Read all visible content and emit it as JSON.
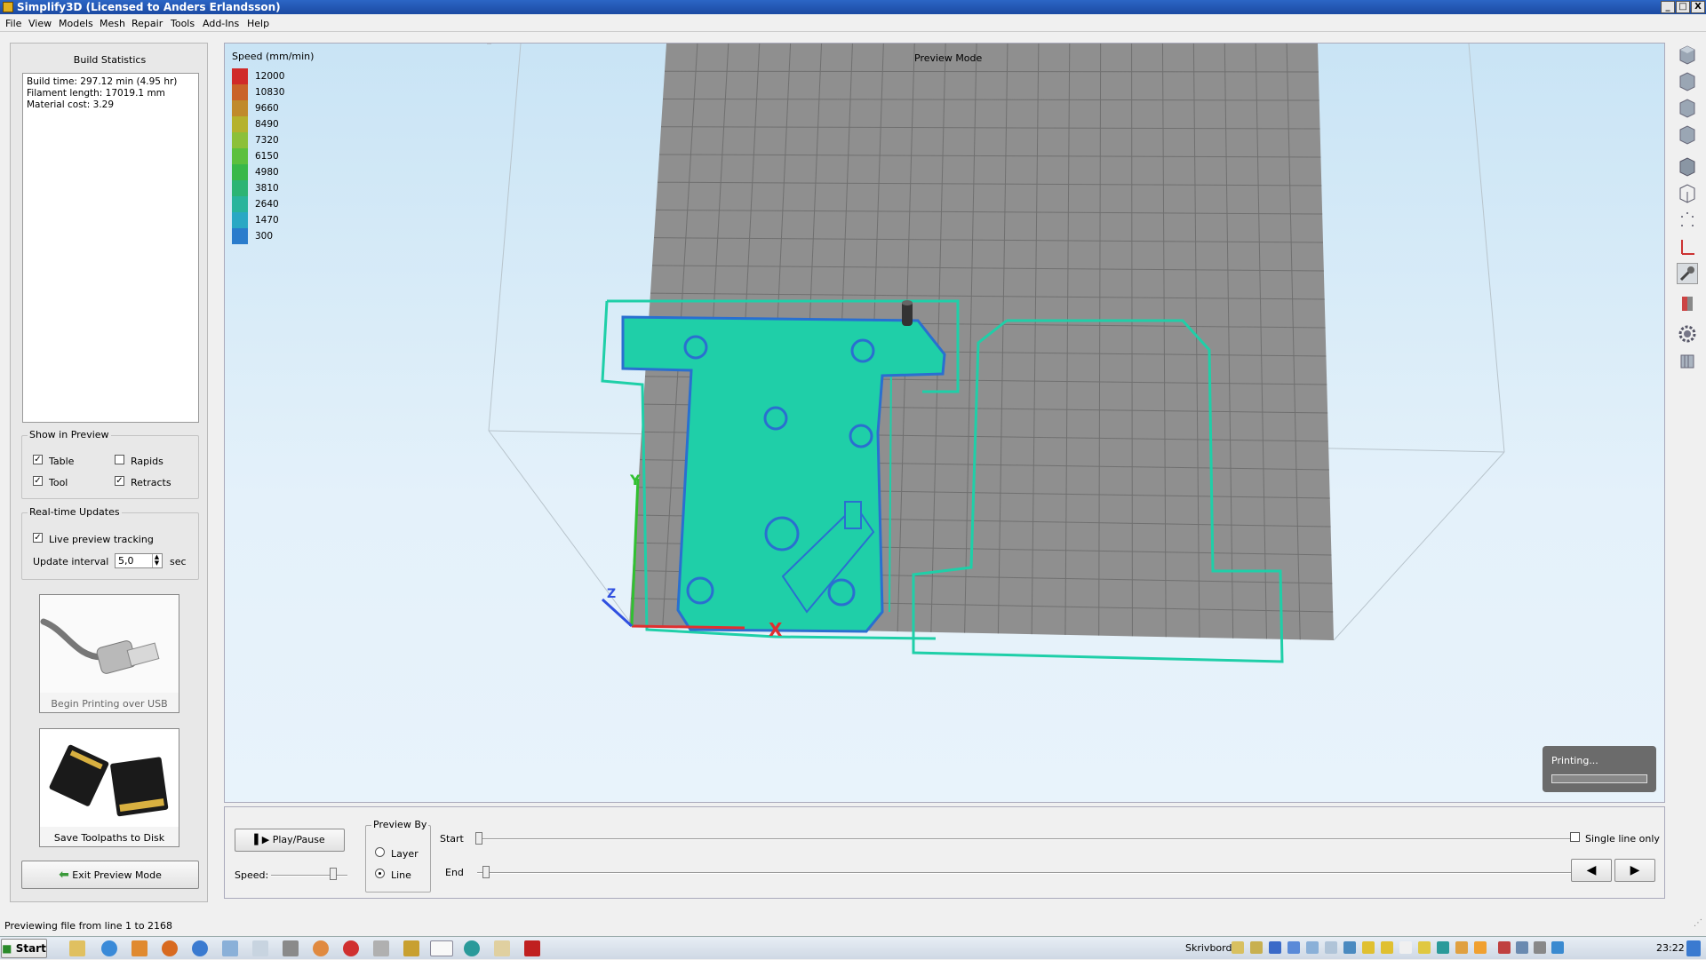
{
  "window": {
    "title": "Simplify3D (Licensed to Anders Erlandsson)",
    "minimize": "_",
    "maximize": "□",
    "close": "X"
  },
  "menu": [
    "File",
    "View",
    "Models",
    "Mesh",
    "Repair",
    "Tools",
    "Add-Ins",
    "Help"
  ],
  "build_stats": {
    "title": "Build Statistics",
    "lines": [
      "Build time: 297.12 min (4.95 hr)",
      "Filament length: 17019.1 mm",
      "Material cost: 3.29"
    ]
  },
  "show_in_preview": {
    "title": "Show in Preview",
    "table": {
      "label": "Table",
      "checked": true
    },
    "rapids": {
      "label": "Rapids",
      "checked": false
    },
    "tool": {
      "label": "Tool",
      "checked": true
    },
    "retracts": {
      "label": "Retracts",
      "checked": true
    }
  },
  "realtime": {
    "title": "Real-time Updates",
    "live_label": "Live preview tracking",
    "live_checked": true,
    "interval_label": "Update interval",
    "interval_value": "5,0",
    "interval_unit": "sec"
  },
  "usb_button": {
    "label": "Begin Printing over USB"
  },
  "sd_button": {
    "label": "Save Toolpaths to Disk"
  },
  "exit_button": {
    "label": "Exit Preview Mode"
  },
  "viewport": {
    "mode_label": "Preview Mode",
    "legend_title": "Speed (mm/min)",
    "legend": [
      {
        "value": "12000",
        "color": "#d02a2a"
      },
      {
        "value": "10830",
        "color": "#c9632a"
      },
      {
        "value": "9660",
        "color": "#c08a2c"
      },
      {
        "value": "8490",
        "color": "#b5b22e"
      },
      {
        "value": "7320",
        "color": "#8cc03a"
      },
      {
        "value": "6150",
        "color": "#5cc03e"
      },
      {
        "value": "4980",
        "color": "#38b84a"
      },
      {
        "value": "3810",
        "color": "#2cb474"
      },
      {
        "value": "2640",
        "color": "#29b49c"
      },
      {
        "value": "1470",
        "color": "#2aa8c4"
      },
      {
        "value": "300",
        "color": "#2a7ccc"
      }
    ],
    "axis_labels": {
      "x": "X",
      "y": "Y",
      "z": "Z"
    }
  },
  "printing_popup": {
    "label": "Printing..."
  },
  "controls": {
    "play_label": "Play/Pause",
    "speed_label": "Speed:",
    "preview_by_title": "Preview By",
    "layer_label": "Layer",
    "line_label": "Line",
    "selected": "Line",
    "start_label": "Start",
    "end_label": "End",
    "single_line_label": "Single line only",
    "single_line_checked": false
  },
  "status": "Previewing file from line 1 to 2168",
  "taskbar": {
    "start": "Start",
    "desktop_label": "Skrivbord",
    "clock": "23:22"
  },
  "colors": {
    "toolpath": "#1fcfa8",
    "toolpath_edge": "#2a6fd0",
    "bed": "#8f8f8f",
    "grid": "#6b6b6b",
    "accent": "#2c66c5"
  }
}
